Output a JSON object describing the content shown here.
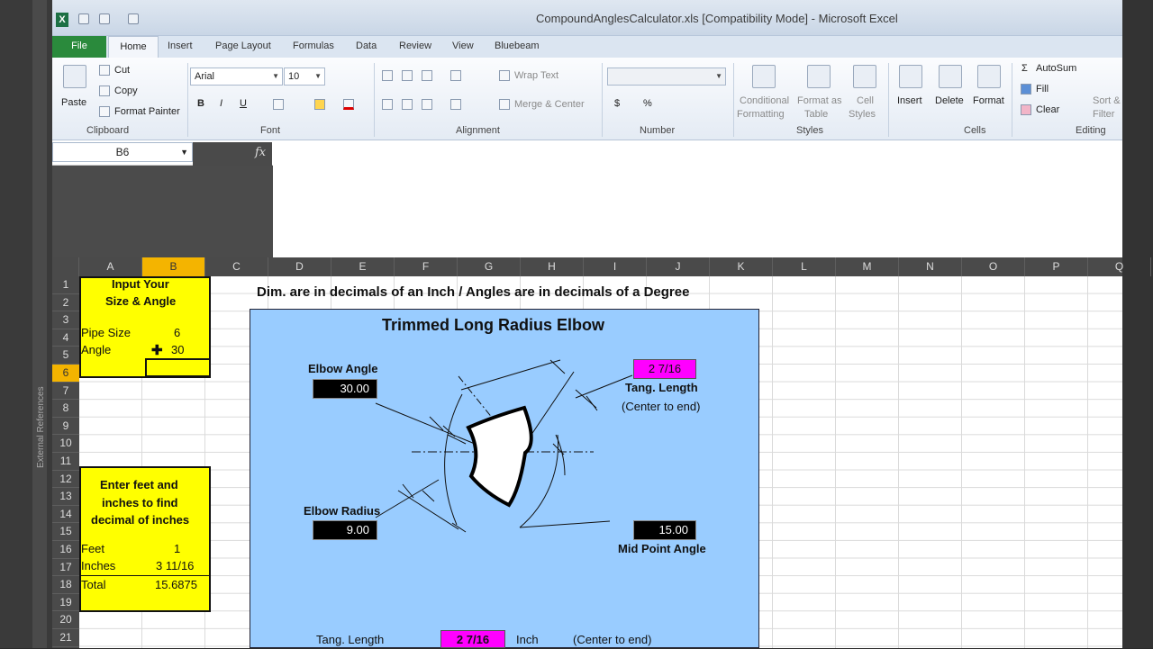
{
  "window": {
    "title": "CompoundAnglesCalculator.xls  [Compatibility Mode]  -  Microsoft Excel"
  },
  "tabs": [
    "File",
    "Home",
    "Insert",
    "Page Layout",
    "Formulas",
    "Data",
    "Review",
    "View",
    "Bluebeam"
  ],
  "ribbon": {
    "clipboard": {
      "paste": "Paste",
      "cut": "Cut",
      "copy": "Copy",
      "format_painter": "Format Painter",
      "label": "Clipboard"
    },
    "font": {
      "name": "Arial",
      "size": "10",
      "label": "Font",
      "bold": "B",
      "italic": "I",
      "underline": "U"
    },
    "alignment": {
      "wrap": "Wrap Text",
      "merge": "Merge & Center",
      "label": "Alignment"
    },
    "number": {
      "label": "Number",
      "currency": "$",
      "percent": "%"
    },
    "styles": {
      "conditional": "Conditional",
      "conditional2": "Formatting",
      "format_table": "Format as",
      "format_table2": "Table",
      "cell_styles": "Cell",
      "cell_styles2": "Styles",
      "label": "Styles"
    },
    "cells": {
      "insert": "Insert",
      "delete": "Delete",
      "format": "Format",
      "label": "Cells"
    },
    "editing": {
      "autosum": "AutoSum",
      "fill": "Fill",
      "clear": "Clear",
      "sort": "Sort &",
      "sort2": "Filter",
      "label": "Editing"
    }
  },
  "formula_bar": {
    "name_box": "B6",
    "fx": "fx",
    "content": ""
  },
  "columns": [
    "A",
    "B",
    "C",
    "D",
    "E",
    "F",
    "G",
    "H",
    "I",
    "J",
    "K",
    "L",
    "M",
    "N",
    "O",
    "P",
    "Q"
  ],
  "rows": [
    "1",
    "2",
    "3",
    "4",
    "5",
    "6",
    "7",
    "8",
    "9",
    "10",
    "11",
    "12",
    "13",
    "14",
    "15",
    "16",
    "17",
    "18",
    "19",
    "20",
    "21"
  ],
  "side_label": "External References",
  "sheet": {
    "input_title1": "Input Your",
    "input_title2": "Size & Angle",
    "pipe_size_label": "Pipe Size",
    "pipe_size_value": "6",
    "angle_label": "Angle",
    "angle_value": "30",
    "feet_title1": "Enter feet and",
    "feet_title2": "inches to find",
    "feet_title3": "decimal of inches",
    "feet_label": "Feet",
    "feet_value": "1",
    "inches_label": "Inches",
    "inches_value": "3 11/16",
    "total_label": "Total",
    "total_value": "15.6875",
    "dim_note": "Dim. are in decimals of an Inch / Angles are in decimals of a Degree"
  },
  "diagram": {
    "title": "Trimmed Long Radius Elbow",
    "elbow_angle_label": "Elbow Angle",
    "elbow_angle_value": "30.00",
    "tang_length_value": "2  7/16",
    "tang_length_label": "Tang. Length",
    "center_to_end": "(Center to end)",
    "elbow_radius_label": "Elbow Radius",
    "elbow_radius_value": "9.00",
    "mid_point_value": "15.00",
    "mid_point_label": "Mid Point Angle",
    "bottom_tang_label": "Tang. Length",
    "bottom_tang_value": "2  7/16",
    "bottom_unit": "Inch",
    "bottom_center": "(Center to end)"
  }
}
